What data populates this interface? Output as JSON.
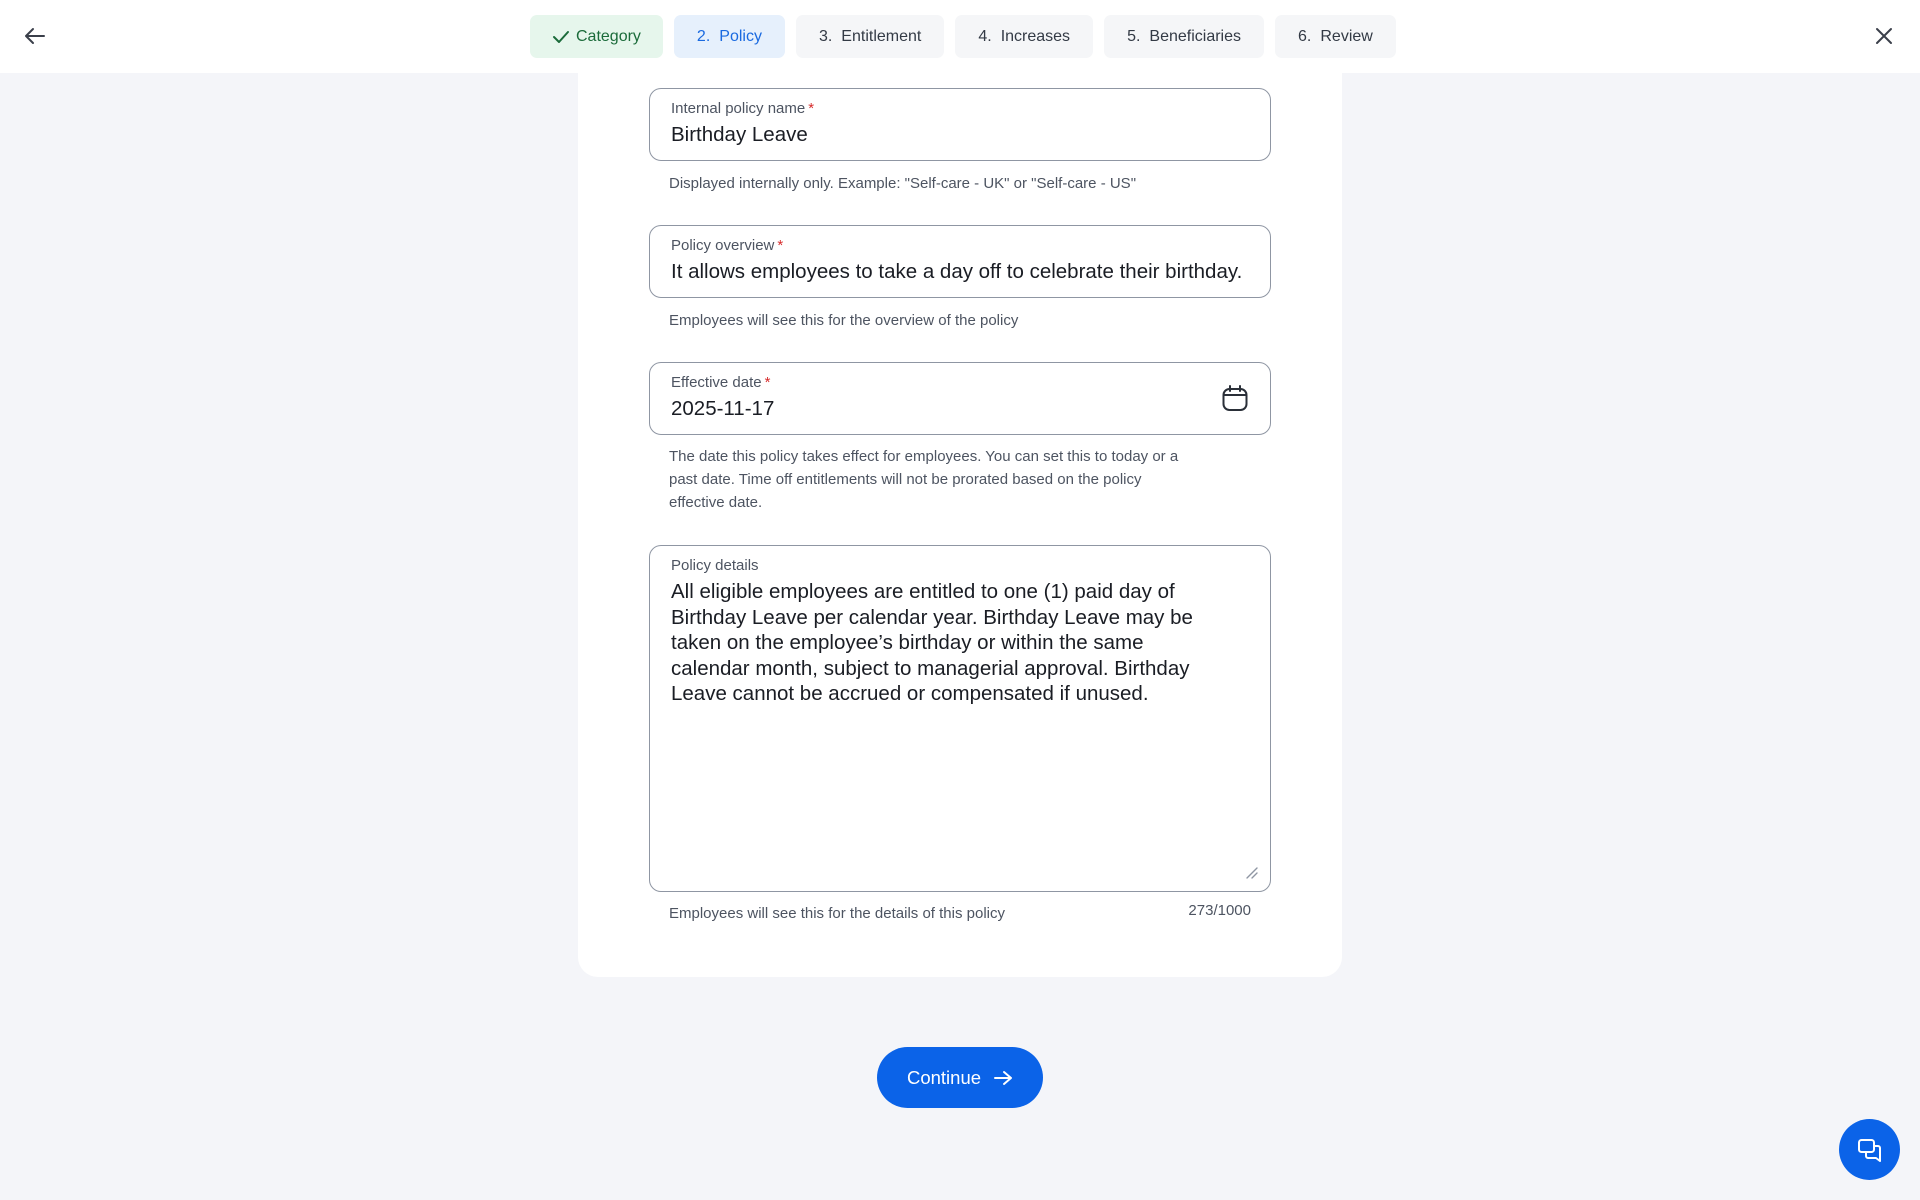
{
  "header": {
    "back_icon": "arrow-left-icon",
    "close_icon": "close-icon",
    "steps": [
      {
        "number": "",
        "label": "Category",
        "state": "done",
        "icon": "check-icon"
      },
      {
        "number": "2.",
        "label": "Policy",
        "state": "active"
      },
      {
        "number": "3.",
        "label": "Entitlement",
        "state": "pending"
      },
      {
        "number": "4.",
        "label": "Increases",
        "state": "pending"
      },
      {
        "number": "5.",
        "label": "Beneficiaries",
        "state": "pending"
      },
      {
        "number": "6.",
        "label": "Review",
        "state": "pending"
      }
    ]
  },
  "form": {
    "internal_name": {
      "label": "Internal policy name",
      "required_mark": "*",
      "value": "Birthday Leave",
      "help": "Displayed internally only. Example: \"Self-care - UK\" or \"Self-care - US\""
    },
    "overview": {
      "label": "Policy overview",
      "required_mark": "*",
      "value": "It allows employees to take a day off to celebrate their birthday.",
      "help": "Employees will see this for the overview of the policy"
    },
    "effective_date": {
      "label": "Effective date",
      "required_mark": "*",
      "value": "2025-11-17",
      "icon": "calendar-icon",
      "help_lines": [
        "The date this policy takes effect for employees. You can set this to today or a",
        "past date. Time off entitlements will not be prorated based on the policy",
        "effective date."
      ]
    },
    "details": {
      "label": "Policy details",
      "lines": [
        "All eligible employees are entitled to one (1) paid day of",
        "Birthday Leave per calendar year. Birthday Leave may be",
        "taken on the employee’s birthday or within the same",
        "calendar month, subject to managerial approval. Birthday",
        "Leave cannot be accrued or compensated if unused."
      ],
      "help": "Employees will see this for the details of this policy",
      "counter": "273/1000"
    }
  },
  "footer": {
    "continue_label": "Continue",
    "continue_icon": "arrow-right-icon",
    "chat_icon": "chat-icon"
  },
  "colors": {
    "primary": "#0b63e8",
    "done_bg": "#e6f6ec",
    "done_text": "#1b6b3a",
    "active_bg": "#e6f0fc",
    "active_text": "#1a6ae0",
    "required": "#d62b2b",
    "page_bg": "#f4f5f9"
  }
}
